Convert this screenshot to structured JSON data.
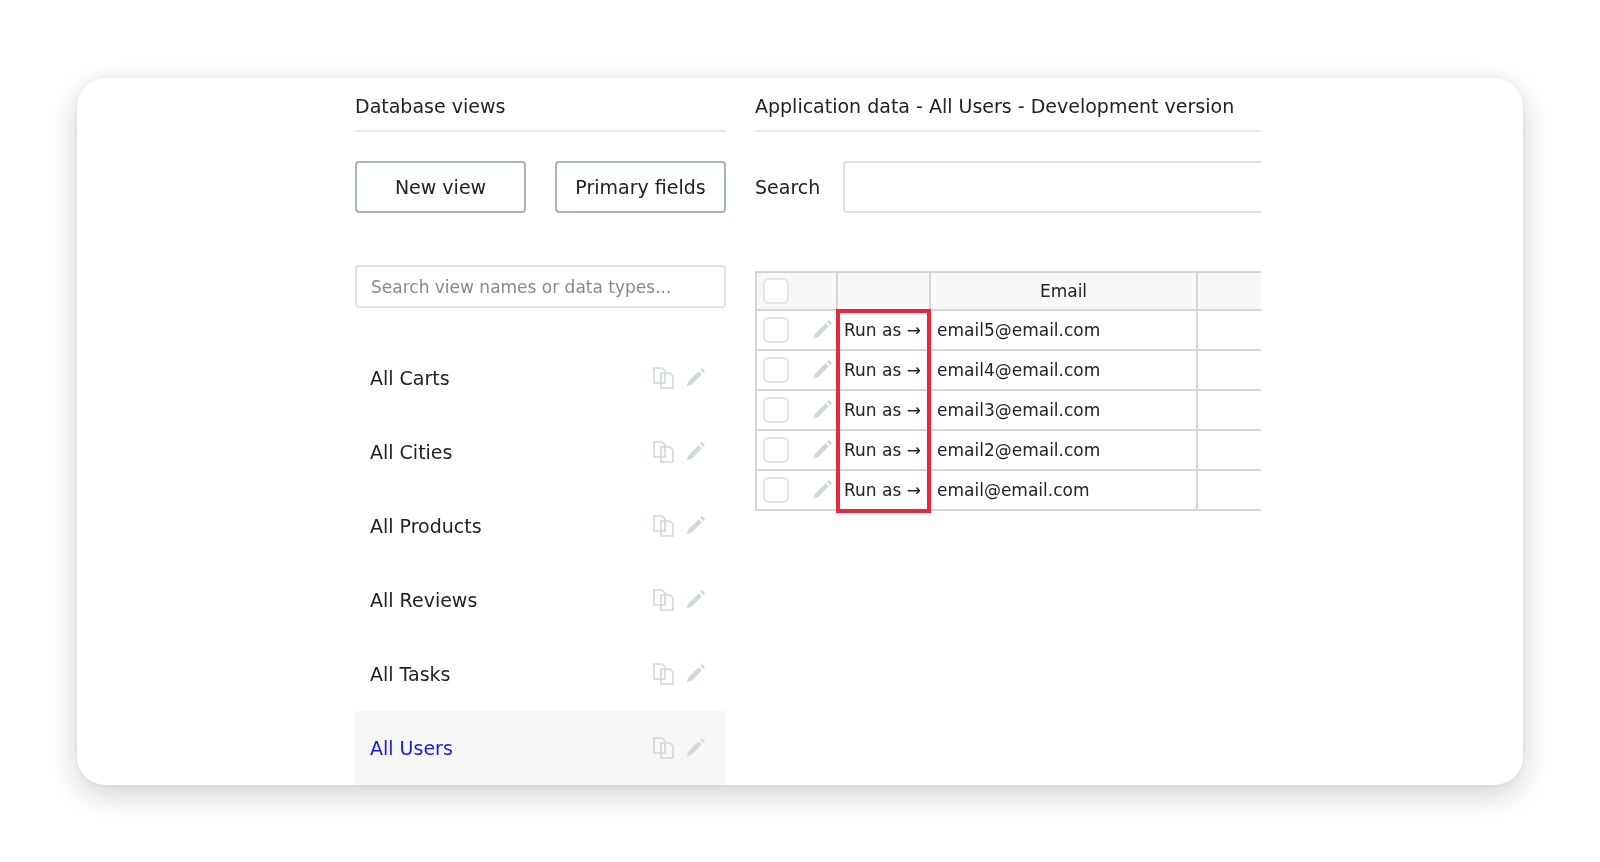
{
  "left_panel": {
    "title": "Database views",
    "buttons": [
      "New view",
      "Primary fields"
    ],
    "search": {
      "placeholder": "Search view names or data types..."
    },
    "views": [
      {
        "label": "All Carts",
        "selected": false
      },
      {
        "label": "All Cities",
        "selected": false
      },
      {
        "label": "All Products",
        "selected": false
      },
      {
        "label": "All Reviews",
        "selected": false
      },
      {
        "label": "All Tasks",
        "selected": false
      },
      {
        "label": "All Users",
        "selected": true
      }
    ]
  },
  "right_panel": {
    "title": "Application data - All Users - Development version",
    "search": {
      "label": "Search"
    },
    "table": {
      "select_all": {
        "checked": false
      },
      "columns": [
        {
          "highlighted": true
        },
        {
          "label": "Email",
          "highlighted": false
        },
        {
          "highlighted": false
        }
      ],
      "rows": [
        {
          "checked": false,
          "action": "Run as →",
          "email": "email5@email.com"
        },
        {
          "checked": false,
          "action": "Run as →",
          "email": "email4@email.com"
        },
        {
          "checked": false,
          "action": "Run as →",
          "email": "email3@email.com"
        },
        {
          "checked": false,
          "action": "Run as →",
          "email": "email2@email.com"
        },
        {
          "checked": false,
          "action": "Run as →",
          "email": "email@email.com"
        }
      ]
    }
  }
}
